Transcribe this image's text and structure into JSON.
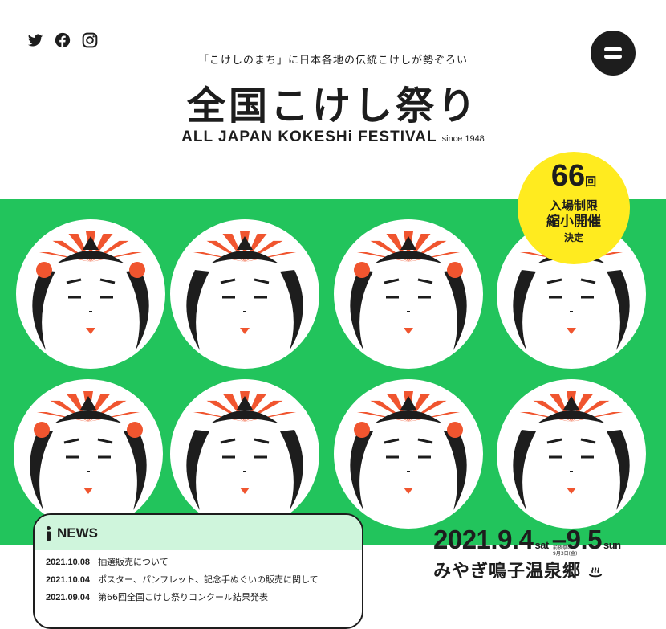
{
  "header": {
    "social": [
      "twitter-icon",
      "facebook-icon",
      "instagram-icon"
    ],
    "tagline": "「こけしのまち」に日本各地の伝統こけしが勢ぞろい",
    "logo_ja": "全国こけし祭り",
    "logo_en": "ALL JAPAN KOKESHi FESTIVAL",
    "since": "since 1948"
  },
  "badge": {
    "number": "66",
    "number_suffix": "回",
    "line1": "入場制限",
    "line2": "縮小開催",
    "line3": "決定"
  },
  "colors": {
    "green": "#22c45c",
    "yellow": "#ffeb1f",
    "red": "#f0552f",
    "dark": "#1d1d1d",
    "news_bg": "#cff5dc"
  },
  "news": {
    "title": "NEWS",
    "items": [
      {
        "date": "2021.10.08",
        "text": "抽選販売について"
      },
      {
        "date": "2021.10.04",
        "text": "ポスター、パンフレット、記念手ぬぐいの販売に関して"
      },
      {
        "date": "2021.09.04",
        "text": "第66回全国こけし祭りコンクール結果発表"
      }
    ]
  },
  "event": {
    "start": "2021.9.4",
    "start_day": "sat",
    "end": "9.5",
    "end_day": "sun",
    "note_line1": "前夜祭は",
    "note_line2": "9月3日(金)",
    "place": "みやぎ鳴子温泉郷",
    "place_icon": "hot-spring-icon"
  }
}
